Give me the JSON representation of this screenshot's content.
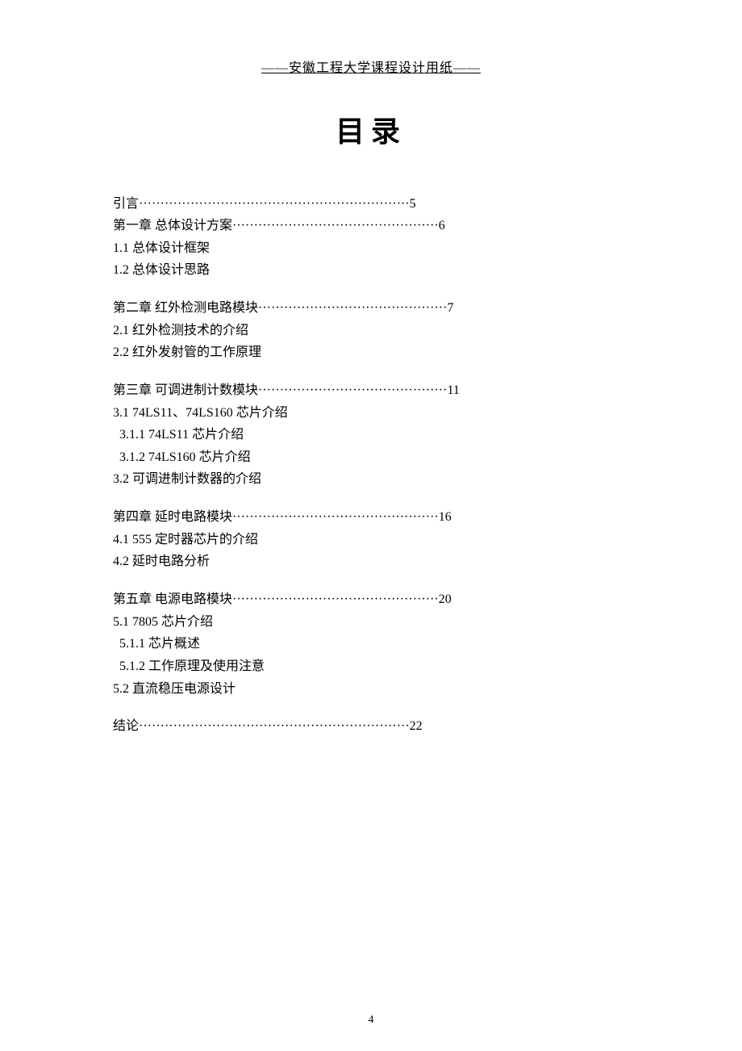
{
  "header": "——安徽工程大学课程设计用纸——",
  "title": "目录",
  "entries": [
    {
      "type": "dotted",
      "label": "引言",
      "page": "5",
      "dots": 63
    },
    {
      "type": "dotted",
      "label": "第一章 总体设计方案",
      "page": "6",
      "dots": 48
    },
    {
      "type": "sub",
      "text": "1.1 总体设计框架"
    },
    {
      "type": "sub",
      "text": "1.2 总体设计思路"
    },
    {
      "type": "gap"
    },
    {
      "type": "dotted",
      "label": "第二章 红外检测电路模块",
      "page": "7",
      "dots": 44
    },
    {
      "type": "sub",
      "text": "2.1 红外检测技术的介绍"
    },
    {
      "type": "sub",
      "text": "2.2 红外发射管的工作原理"
    },
    {
      "type": "gap"
    },
    {
      "type": "dotted",
      "label": "第三章 可调进制计数模块",
      "page": "11",
      "dots": 44
    },
    {
      "type": "sub",
      "text": "3.1 74LS11、74LS160 芯片介绍"
    },
    {
      "type": "subsub",
      "text": "3.1.1 74LS11 芯片介绍"
    },
    {
      "type": "subsub",
      "text": "3.1.2 74LS160 芯片介绍"
    },
    {
      "type": "sub",
      "text": "3.2 可调进制计数器的介绍"
    },
    {
      "type": "gap"
    },
    {
      "type": "dotted",
      "label": "第四章 延时电路模块",
      "page": "16",
      "dots": 48
    },
    {
      "type": "sub",
      "text": "4.1 555 定时器芯片的介绍"
    },
    {
      "type": "sub",
      "text": "4.2 延时电路分析"
    },
    {
      "type": "gap"
    },
    {
      "type": "dotted",
      "label": "第五章 电源电路模块",
      "page": "20",
      "dots": 48
    },
    {
      "type": "sub",
      "text": "5.1 7805 芯片介绍"
    },
    {
      "type": "subsub",
      "text": "5.1.1 芯片概述"
    },
    {
      "type": "subsub",
      "text": "5.1.2 工作原理及使用注意"
    },
    {
      "type": "sub",
      "text": "5.2 直流稳压电源设计"
    },
    {
      "type": "gap"
    },
    {
      "type": "dotted",
      "label": "结论",
      "page": "22",
      "dots": 63
    }
  ],
  "pageNumber": "4"
}
